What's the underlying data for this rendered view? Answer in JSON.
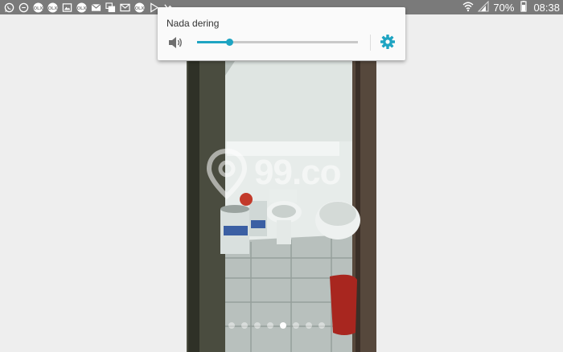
{
  "status_bar": {
    "notification_icons": [
      "whatsapp-icon",
      "message-icon",
      "sale-icon",
      "sale-icon",
      "image-icon",
      "sale-icon",
      "mail-icon",
      "gallery-icon",
      "email-icon",
      "sale-icon",
      "play-store-icon",
      "missed-call-icon"
    ],
    "battery": "70%",
    "time": "08:38"
  },
  "volume_panel": {
    "title": "Nada dering",
    "level_fraction": 0.2,
    "accent_color": "#1ea4c2"
  },
  "photo": {
    "watermark": "99.co",
    "page_count": 8,
    "active_page": 5
  }
}
